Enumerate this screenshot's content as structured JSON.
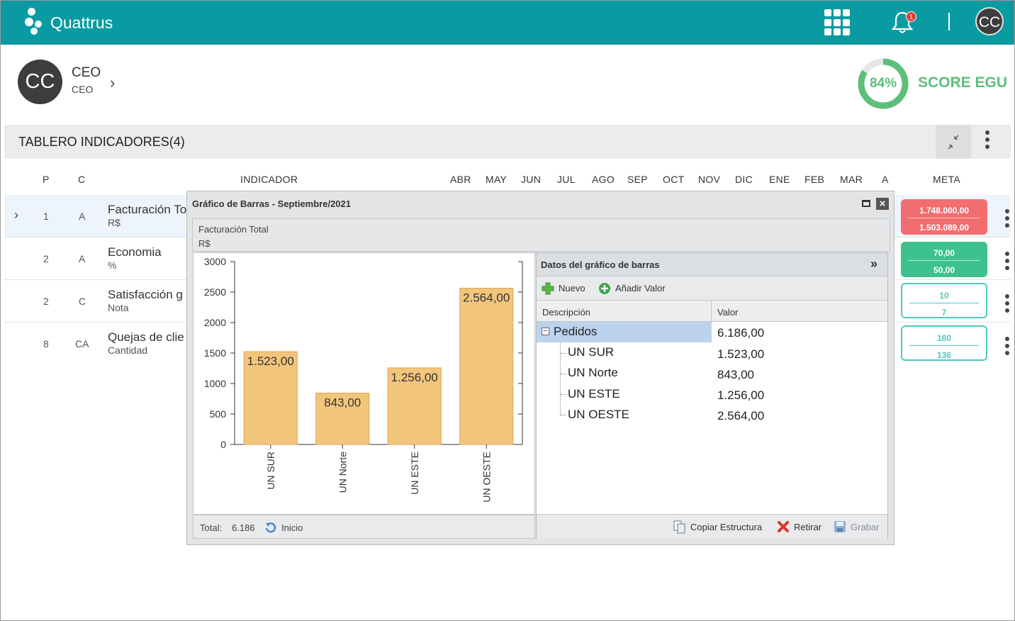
{
  "app": {
    "brand": "Quattrus",
    "notifications": "1",
    "user_initials": "CC"
  },
  "profile": {
    "initials": "CC",
    "name": "CEO",
    "role": "CEO",
    "score_pct": "84%",
    "score_value": 0.84,
    "score_label": "SCORE EGU"
  },
  "panel": {
    "title": "TABLERO INDICADORES(4)"
  },
  "table": {
    "headers": {
      "p": "P",
      "c": "C",
      "indicador": "INDICADOR",
      "months": [
        "ABR",
        "MAY",
        "JUN",
        "JUL",
        "AGO",
        "SEP",
        "OCT",
        "NOV",
        "DIC",
        "ENE",
        "FEB",
        "MAR",
        "A"
      ],
      "meta": "META"
    },
    "rows": [
      {
        "p": "1",
        "c": "A",
        "name": "Facturación To",
        "unit": "R$",
        "meta_a": "1.748.000,00",
        "meta_b": "1.503.089,00",
        "meta_color": "#f26d6f"
      },
      {
        "p": "2",
        "c": "A",
        "name": "Economia",
        "unit": "%",
        "meta_a": "70,00",
        "meta_b": "50,00",
        "meta_color": "#3dc28f"
      },
      {
        "p": "2",
        "c": "C",
        "name": "Satisfacción g",
        "unit": "Nota",
        "meta_a": "10",
        "meta_b": "7",
        "meta_color": "#4ec9c2"
      },
      {
        "p": "8",
        "c": "CA",
        "name": "Quejas de clie",
        "unit": "Cantidad",
        "meta_a": "180",
        "meta_b": "136",
        "meta_color": "#4ec9c2"
      }
    ]
  },
  "dialog": {
    "title": "Gráfico de Barras - Septiembre/2021",
    "chart_title": "Facturación Total",
    "chart_unit": "R$",
    "footer_total_label": "Total:",
    "footer_total_value": "6.186",
    "footer_home": "Inicio"
  },
  "chart_data": {
    "type": "bar",
    "categories": [
      "UN SUR",
      "UN Norte",
      "UN ESTE",
      "UN OESTE"
    ],
    "values": [
      1523,
      843,
      1256,
      2564
    ],
    "labels": [
      "1.523,00",
      "843,00",
      "1.256,00",
      "2.564,00"
    ],
    "yticks": [
      "0",
      "500",
      "1000",
      "1500",
      "2000",
      "2500",
      "3000"
    ],
    "ylim": [
      0,
      3000
    ],
    "bar_color": "#f2c57c"
  },
  "data_panel": {
    "title": "Datos del gráfico de barras",
    "btn_new": "Nuevo",
    "btn_add": "Añadir Valor",
    "col_desc": "Descripción",
    "col_val": "Valor",
    "root": {
      "name": "Pedidos",
      "value": "6.186,00"
    },
    "children": [
      {
        "name": "UN SUR",
        "value": "1.523,00"
      },
      {
        "name": "UN Norte",
        "value": "843,00"
      },
      {
        "name": "UN ESTE",
        "value": "1.256,00"
      },
      {
        "name": "UN OESTE",
        "value": "2.564,00"
      }
    ],
    "btn_copy": "Copiar Estructura",
    "btn_remove": "Retirar",
    "btn_save": "Grabar"
  }
}
